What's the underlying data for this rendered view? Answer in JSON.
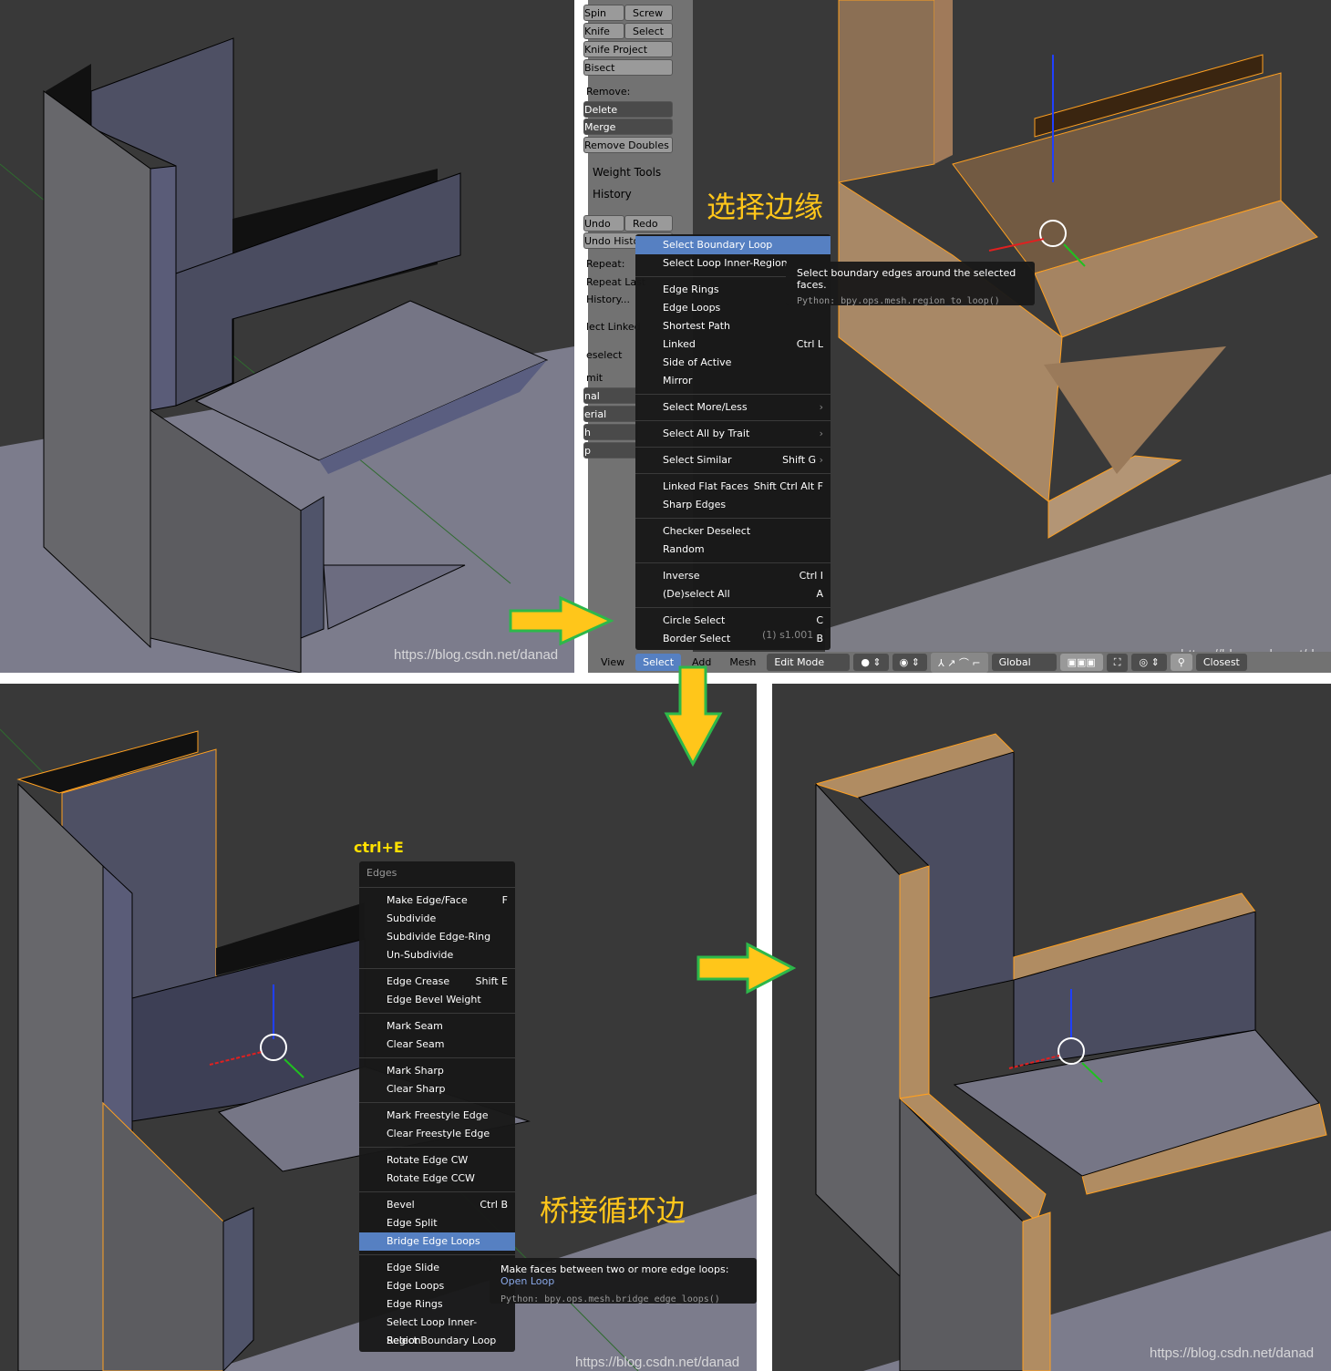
{
  "watermark": "https://blog.csdn.net/danad",
  "toolshelf": {
    "buttons": [
      [
        "Spin",
        "Screw"
      ],
      [
        "Knife",
        "Select"
      ]
    ],
    "knife_project": "Knife Project",
    "bisect": "Bisect",
    "remove_label": "Remove:",
    "delete": "Delete",
    "merge": "Merge",
    "remove_doubles": "Remove Doubles",
    "weight_tools": "Weight Tools",
    "history": "History",
    "undo": "Undo",
    "redo": "Redo",
    "undo_history": "Undo History",
    "repeat_label": "Repeat:",
    "repeat_last": "Repeat Last",
    "history_dots": "History...",
    "partial": [
      "lect Linked",
      "eselect",
      "mit",
      "nal",
      "erial",
      "h",
      "p"
    ]
  },
  "select_menu": {
    "groups": [
      [
        {
          "label": "Select Boundary Loop",
          "highlight": true
        },
        {
          "label": "Select Loop Inner-Region"
        }
      ],
      [
        {
          "label": "Edge Rings"
        },
        {
          "label": "Edge Loops"
        },
        {
          "label": "Shortest Path"
        },
        {
          "label": "Linked",
          "shortcut": "Ctrl L"
        },
        {
          "label": "Side of Active"
        },
        {
          "label": "Mirror"
        }
      ],
      [
        {
          "label": "Select More/Less",
          "submenu": true
        }
      ],
      [
        {
          "label": "Select All by Trait",
          "submenu": true
        }
      ],
      [
        {
          "label": "Select Similar",
          "shortcut": "Shift G",
          "submenu": true
        }
      ],
      [
        {
          "label": "Linked Flat Faces",
          "shortcut": "Shift Ctrl Alt F"
        },
        {
          "label": "Sharp Edges"
        }
      ],
      [
        {
          "label": "Checker Deselect"
        },
        {
          "label": "Random"
        }
      ],
      [
        {
          "label": "Inverse",
          "shortcut": "Ctrl I"
        },
        {
          "label": "(De)select All",
          "shortcut": "A"
        }
      ],
      [
        {
          "label": "Circle Select",
          "shortcut": "C"
        },
        {
          "label": "Border Select",
          "shortcut": "B"
        }
      ]
    ],
    "tooltip": "Select boundary edges around the selected faces.",
    "python": "Python: bpy.ops.mesh.region_to_loop()"
  },
  "object_label": "(1) s1.001",
  "header": {
    "view": "View",
    "select": "Select",
    "add": "Add",
    "mesh": "Mesh",
    "mode": "Edit Mode",
    "orientation": "Global",
    "snap": "Closest"
  },
  "annotations": {
    "select_edges_cn": "选择边缘",
    "ctrl_e": "ctrl+E",
    "bridge_cn": "桥接循环边"
  },
  "edges_menu": {
    "title": "Edges",
    "groups": [
      [
        {
          "label": "Make Edge/Face",
          "shortcut": "F"
        },
        {
          "label": "Subdivide"
        },
        {
          "label": "Subdivide Edge-Ring"
        },
        {
          "label": "Un-Subdivide"
        }
      ],
      [
        {
          "label": "Edge Crease",
          "shortcut": "Shift E"
        },
        {
          "label": "Edge Bevel Weight"
        }
      ],
      [
        {
          "label": "Mark Seam"
        },
        {
          "label": "Clear Seam"
        }
      ],
      [
        {
          "label": "Mark Sharp"
        },
        {
          "label": "Clear Sharp"
        }
      ],
      [
        {
          "label": "Mark Freestyle Edge"
        },
        {
          "label": "Clear Freestyle Edge"
        }
      ],
      [
        {
          "label": "Rotate Edge CW"
        },
        {
          "label": "Rotate Edge CCW"
        }
      ],
      [
        {
          "label": "Bevel",
          "shortcut": "Ctrl B"
        },
        {
          "label": "Edge Split"
        },
        {
          "label": "Bridge Edge Loops",
          "highlight": true
        }
      ],
      [
        {
          "label": "Edge Slide"
        },
        {
          "label": "Edge Loops"
        },
        {
          "label": "Edge Rings"
        },
        {
          "label": "Select Loop Inner-Region"
        },
        {
          "label": "Select Boundary Loop"
        }
      ]
    ],
    "tooltip": "Make faces between two or more edge loops:",
    "tooltip_extra": "Open Loop",
    "python": "Python: bpy.ops.mesh.bridge_edge_loops()"
  },
  "colors": {
    "viewport": "#393939",
    "selection": "#ffa020",
    "menu_highlight": "#5680c2",
    "arrow": "#ffc61a",
    "arrow_outline": "#2db84a"
  }
}
